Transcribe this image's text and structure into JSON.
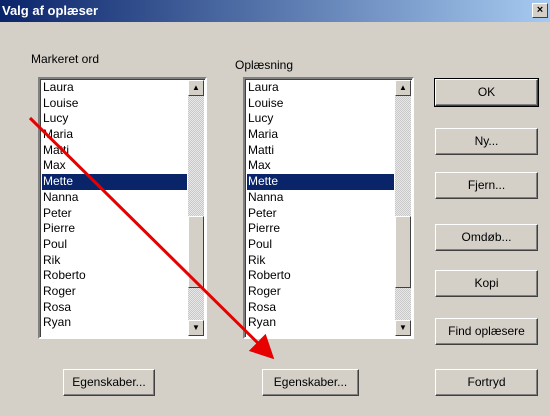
{
  "window": {
    "title": "Valg af oplæser",
    "close_glyph": "×"
  },
  "left_panel": {
    "label": "Markeret ord",
    "items": [
      "Laura",
      "Louise",
      "Lucy",
      "Maria",
      "Matti",
      "Max",
      "Mette",
      "Nanna",
      "Peter",
      "Pierre",
      "Poul",
      "Rik",
      "Roberto",
      "Roger",
      "Rosa",
      "Ryan"
    ],
    "selected": "Mette",
    "properties_button": "Egenskaber..."
  },
  "right_panel": {
    "label": "Oplæsning",
    "items": [
      "Laura",
      "Louise",
      "Lucy",
      "Maria",
      "Matti",
      "Max",
      "Mette",
      "Nanna",
      "Peter",
      "Pierre",
      "Poul",
      "Rik",
      "Roberto",
      "Roger",
      "Rosa",
      "Ryan"
    ],
    "selected": "Mette",
    "properties_button": "Egenskaber..."
  },
  "buttons": {
    "ok": "OK",
    "new": "Ny...",
    "remove": "Fjern...",
    "rename": "Omdøb...",
    "copy": "Kopi",
    "find": "Find oplæsere",
    "cancel": "Fortryd"
  },
  "scroll_arrows": {
    "up": "▲",
    "down": "▼"
  },
  "colors": {
    "selection": "#0a246a",
    "annotation_arrow": "#e60000"
  }
}
